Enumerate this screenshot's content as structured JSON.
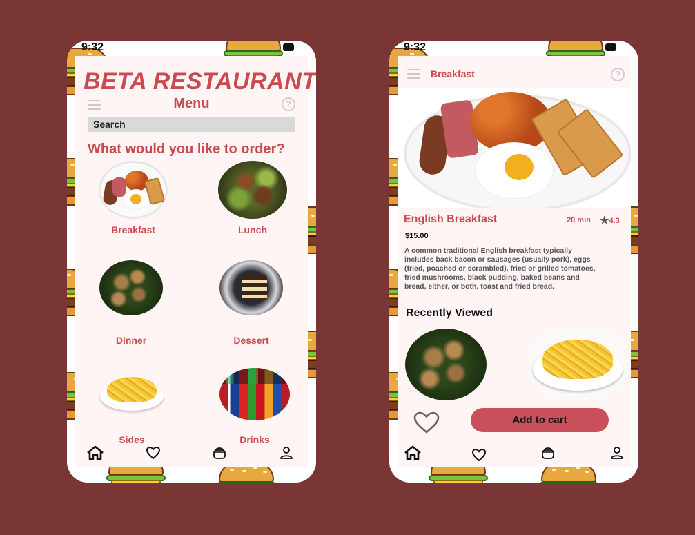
{
  "status_bar": {
    "time": "9:32"
  },
  "menu_screen": {
    "brand": "BETA RESTAURANT",
    "title": "Menu",
    "help": "?",
    "search_placeholder": "Search",
    "question": "What would you like to order?",
    "categories": [
      {
        "label": "Breakfast"
      },
      {
        "label": "Lunch"
      },
      {
        "label": "Dinner"
      },
      {
        "label": "Dessert"
      },
      {
        "label": "Sides"
      },
      {
        "label": "Drinks"
      }
    ]
  },
  "detail_screen": {
    "header_title": "Breakfast",
    "help": "?",
    "dish_name": "English Breakfast",
    "time": "20 min",
    "rating": "4.3",
    "price": "$15.00",
    "description": "A common traditional English breakfast typically includes back bacon or sausages (usually pork), eggs (fried, poached or scrambled), fried or grilled tomatoes, fried mushrooms, black pudding, baked beans and bread, either, or both, toast and fried bread.",
    "recent_title": "Recently Viewed",
    "add_to_cart": "Add to cart"
  },
  "nav": {
    "icons": [
      "home-icon",
      "heart-icon",
      "basket-icon",
      "profile-icon"
    ]
  },
  "colors": {
    "background": "#7a3535",
    "accent": "#c94b50",
    "screen": "#fff5f4",
    "button": "#c9505a"
  }
}
